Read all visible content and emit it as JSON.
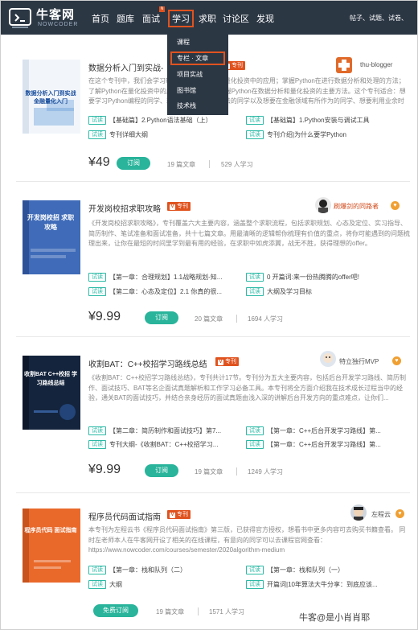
{
  "nav": {
    "brand": "牛客网",
    "brand_sub": "NOWCODER",
    "items": [
      "首页",
      "题库",
      "面试",
      "学习",
      "求职",
      "讨论区",
      "发现"
    ],
    "new_badge": "N",
    "right_text": "帖子、试题、试卷、"
  },
  "dropdown": {
    "items": [
      "课程",
      "专栏 · 文章",
      "项目实战",
      "图书馆",
      "技术栈"
    ]
  },
  "tag_label": "试读",
  "cards": [
    {
      "title": "数据分析入门到实战-",
      "badge": "专刊",
      "author": "thu-blogger",
      "cover_title": "数据分析入门到实战 金融量化入门",
      "desc": "在这个专刊中，我们会学习Python在数据分析和量化投资中的应用；掌握Python在进行数据分析和处理的方法；了解Python在量化投资中的应用，掌握... 熟练掌握Python在数据分析和量化投资的主要方法。这个专刊适合：想要学习Python编程的同学、想要掌握数据分析方法的同学以及想要在金融领域有所作为的同学、想要利用业余时间...",
      "chapters": [
        "【基础篇】2.Python语法基础（上）",
        "【基础篇】1.Python安装与调试工具",
        "专刊详细大纲",
        "专刊介绍|为什么要学Python"
      ],
      "price": "¥49",
      "button": "订阅",
      "articles": "19 篇文章",
      "learners": "529 人学习"
    },
    {
      "title": "开发岗校招求职攻略",
      "badge": "专刊",
      "author": "刷爆剑的同路者",
      "cover_title": "开发岗校招 求职攻略",
      "desc": "《开发岗校招求职攻略》，专刊覆盖六大主要内容，涵盖整个求职流程，包括求职规划、心态及定位、实习指导、简历制作、笔试准备和面试准备，共十七篇文章。用最清晰的逻辑帮你梳理有价值的重点，将你可能遇到的问题梳理出来，让你在最短的时间里学到最有用的经验，在求职中如虎添翼，战无不胜，获得理想的offer。",
      "chapters": [
        "【第一章：合理规划】1.1战略规划-知...",
        "0 开篇词:来一份热腾腾的offer吧!",
        "【第二章：心态及定位】2.1 你真的很...",
        "大纲及学习目标"
      ],
      "price": "¥9.99",
      "button": "订阅",
      "articles": "20 篇文章",
      "learners": "1694 人学习"
    },
    {
      "title": "收割BAT：C++校招学习路线总结",
      "badge": "专刊",
      "author": "特立独行MVP",
      "cover_title": "收割BAT C++校招 学习路线总结",
      "desc": "《收割BAT：C++校招学习路线总结》，专刊共计17节。专刊分为五大主要内容，包括后台开发学习路线、简历制作、面试技巧、BAT等名企面试真题解析和工作学习必备工具。本专刊将全方面介绍我在技术成长过程当中的经验，通关BAT的面试技巧，并结合亲身经历的面试真题由浅入深的讲解后台开发方向的重点难点，让你们...",
      "chapters": [
        "【第二章：简历制作和面试技巧】第7...",
        "【第一章：C++后台开发学习路线】第...",
        "专刊大纲-《收割BAT：C++校招学习...",
        "【第一章：C++后台开发学习路线】第..."
      ],
      "price": "¥9.99",
      "button": "订阅",
      "articles": "19 篇文章",
      "learners": "1249 人学习"
    },
    {
      "title": "程序员代码面试指南",
      "badge": "专刊",
      "author": "左程云",
      "cover_title": "程序员代码 面试指南",
      "desc": "本专刊为左程云书《程序员代码面试指南》第三版，已获得官方授权，想看书中更多内容可去购买书籍查看。 同时左老师本人在牛客网开设了相关的在线课程，有意向的同学可以去课程官网查看：https://www.nowcoder.com/courses/semester/2020algorithm-medium",
      "chapters": [
        "【第一章：栈和队列（二）",
        "【第一章：栈和队列（一）",
        "大纲",
        "开篇词|10年算法大牛分享：到底应该..."
      ],
      "price": "",
      "button": "免费订阅",
      "articles": "19 篇文章",
      "learners": "1571 人学习"
    }
  ],
  "watermark": "牛客@是小肖肖耶"
}
